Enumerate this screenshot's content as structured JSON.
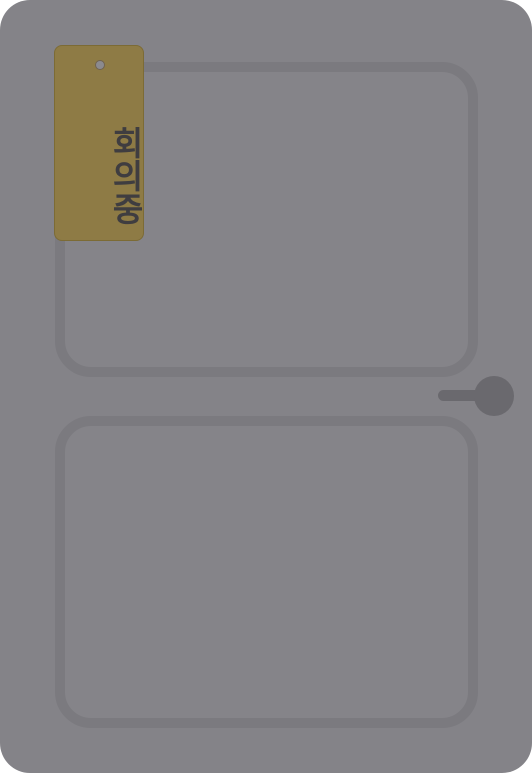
{
  "door": {
    "sign": {
      "text": "회의중",
      "color": "#8e7b45",
      "text_color": "#3f3d40"
    },
    "color": "#848388",
    "handle_color": "#6a696e"
  }
}
